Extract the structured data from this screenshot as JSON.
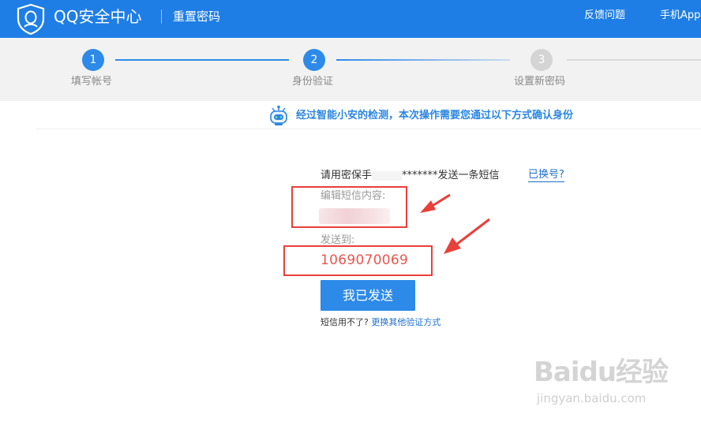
{
  "header": {
    "brand": "QQ安全中心",
    "page_name": "重置密码",
    "nav": {
      "feedback": "反馈问题",
      "app": "手机App"
    }
  },
  "steps": [
    {
      "number": "1",
      "label": "填写帐号",
      "state": "done"
    },
    {
      "number": "2",
      "label": "身份验证",
      "state": "current"
    },
    {
      "number": "3",
      "label": "设置新密码",
      "state": "upcoming"
    }
  ],
  "notice": {
    "text": "经过智能小安的检测，本次操作需要您通过以下方式确认身份"
  },
  "sms": {
    "prefix": "请用密保手",
    "masked": "*******发送一条短信",
    "change_account": "已换号?",
    "content_label": "编辑短信内容:",
    "send_to_label": "发送到:",
    "number": "1069070069",
    "send_button": "我已发送",
    "help_text": "短信用不了?",
    "help_link": "更换其他验证方式"
  },
  "watermark": {
    "brand": "Baidu经验",
    "url": "jingyan.baidu.com"
  },
  "colors": {
    "primary": "#1e7ee6",
    "accent_red": "#e8403b",
    "link": "#1e6fce",
    "number": "#e9564f"
  }
}
